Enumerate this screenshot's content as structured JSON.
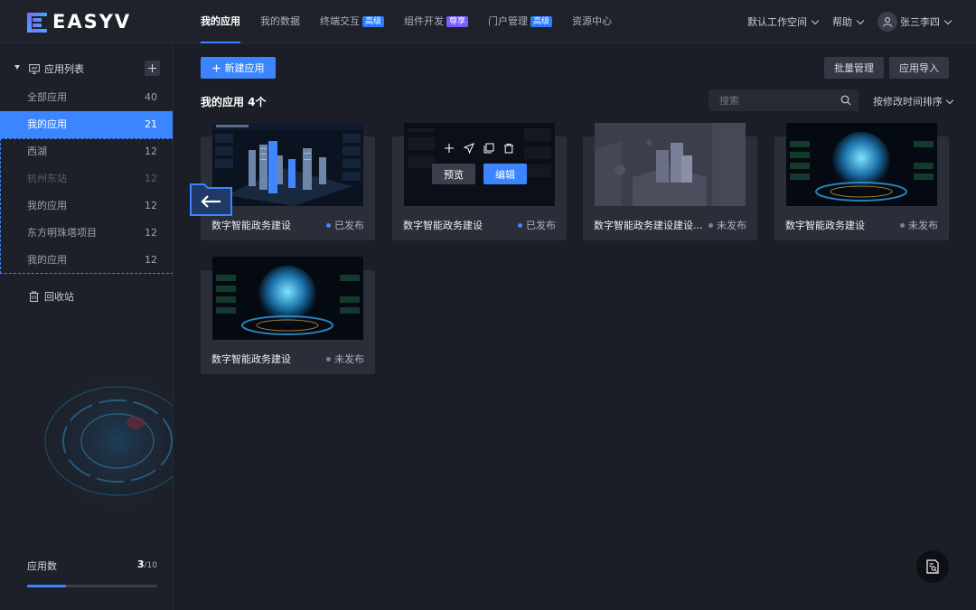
{
  "app": {
    "logo_text": "EASYV"
  },
  "nav": {
    "items": [
      {
        "label": "我的应用",
        "badge": ""
      },
      {
        "label": "我的数据",
        "badge": ""
      },
      {
        "label": "终端交互",
        "badge": "高级"
      },
      {
        "label": "组件开发",
        "badge": "尊享"
      },
      {
        "label": "门户管理",
        "badge": "高级"
      },
      {
        "label": "资源中心",
        "badge": ""
      }
    ],
    "workspace": "默认工作空间",
    "help": "帮助",
    "user": "张三李四"
  },
  "sidebar": {
    "title": "应用列表",
    "items": [
      {
        "label": "全部应用",
        "count": "40"
      },
      {
        "label": "我的应用",
        "count": "21"
      },
      {
        "label": "西湖",
        "count": "12"
      },
      {
        "label": "杭州东站",
        "count": "12"
      },
      {
        "label": "我的应用",
        "count": "12"
      },
      {
        "label": "东方明珠塔项目",
        "count": "12"
      },
      {
        "label": "我的应用",
        "count": "12"
      }
    ],
    "recycle": "回收站",
    "app_count_label": "应用数",
    "app_count_used": "3",
    "app_count_total": "/10",
    "usage_fraction": 0.3
  },
  "toolbar": {
    "new_app": "新建应用",
    "batch_manage": "批量管理",
    "import_app": "应用导入",
    "search_placeholder": "搜索",
    "sort_label": "按修改时间排序"
  },
  "section": {
    "title": "我的应用  4个"
  },
  "cards": [
    {
      "name": "数字智能政务建设",
      "status": "已发布",
      "published": true,
      "thumb": "city"
    },
    {
      "name": "数字智能政务建设",
      "status": "已发布",
      "published": true,
      "thumb": "dark-hover",
      "preview": "预览",
      "edit": "编辑"
    },
    {
      "name": "数字智能政务建设建设...",
      "status": "未发布",
      "published": false,
      "thumb": "placeholder"
    },
    {
      "name": "数字智能政务建设",
      "status": "未发布",
      "published": false,
      "thumb": "globe"
    },
    {
      "name": "数字智能政务建设",
      "status": "未发布",
      "published": false,
      "thumb": "globe"
    }
  ],
  "colors": {
    "accent": "#3b86ff",
    "bg": "#1b1e26",
    "card": "#2a2e38"
  }
}
